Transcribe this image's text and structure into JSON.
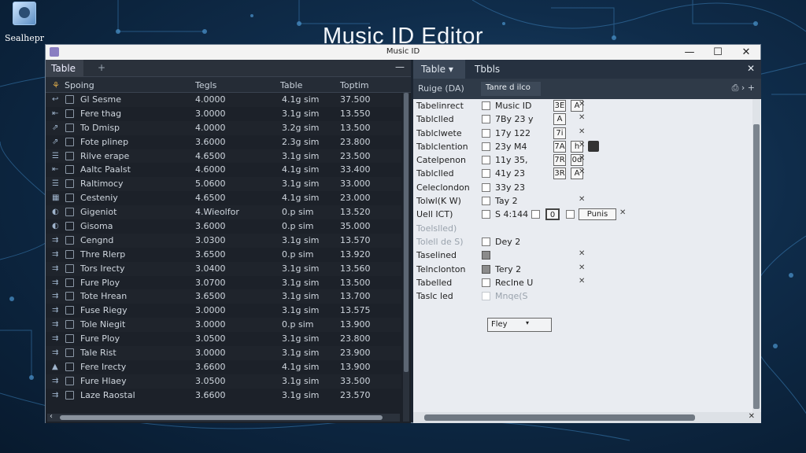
{
  "desktop": {
    "icon_label": "Sealhepr"
  },
  "heading": "Music ID Editor",
  "window": {
    "title": "Music ID",
    "controls": {
      "minimize": "—",
      "maximize": "☐",
      "close": "✕"
    }
  },
  "left_pane": {
    "tab": "Table",
    "add_tab": "+",
    "minimize": "—",
    "columns": [
      "Spoing",
      "Tegls",
      "Table",
      "Toptim"
    ],
    "rows": [
      {
        "icon": "↩",
        "name": "Gl Sesme",
        "c2": "4.0000",
        "c3": "4.1g sim",
        "c4": "37.500"
      },
      {
        "icon": "⇤",
        "name": "Fere thag",
        "c2": "3.0000",
        "c3": "3.1g sim",
        "c4": "13.550"
      },
      {
        "icon": "⇗",
        "name": "To Dmisp",
        "c2": "4.0000",
        "c3": "3.2g sim",
        "c4": "13.500"
      },
      {
        "icon": "⇗",
        "name": "Fote plinep",
        "c2": "3.6000",
        "c3": "2.3g sim",
        "c4": "23.800"
      },
      {
        "icon": "☰",
        "name": "Rilve erape",
        "c2": "4.6500",
        "c3": "3.1g sim",
        "c4": "23.500"
      },
      {
        "icon": "⇤",
        "name": "Aaltc Paalst",
        "c2": "4.6000",
        "c3": "4.1g sim",
        "c4": "33.400"
      },
      {
        "icon": "☰",
        "name": "Raltimocy",
        "c2": "5.0600",
        "c3": "3.1g sim",
        "c4": "33.000"
      },
      {
        "icon": "▦",
        "name": "Cesteniy",
        "c2": "4.6500",
        "c3": "4.1g sim",
        "c4": "23.000"
      },
      {
        "icon": "◐",
        "name": "Gigeniot",
        "c2": "4.Wieolfor",
        "c3": "0.p sim",
        "c4": "13.520"
      },
      {
        "icon": "◐",
        "name": "Gisoma",
        "c2": "3.6000",
        "c3": "0.p sim",
        "c4": "35.000"
      },
      {
        "icon": "⇉",
        "name": "Cengnd",
        "c2": "3.0300",
        "c3": "3.1g sim",
        "c4": "13.570"
      },
      {
        "icon": "⇉",
        "name": "Thre Rlerp",
        "c2": "3.6500",
        "c3": "0.p sim",
        "c4": "13.920"
      },
      {
        "icon": "⇉",
        "name": "Tors Irecty",
        "c2": "3.0400",
        "c3": "3.1g sim",
        "c4": "13.560"
      },
      {
        "icon": "⇉",
        "name": "Fure Ploy",
        "c2": "3.0700",
        "c3": "3.1g sim",
        "c4": "13.500"
      },
      {
        "icon": "⇉",
        "name": "Tote Hrean",
        "c2": "3.6500",
        "c3": "3.1g sim",
        "c4": "13.700"
      },
      {
        "icon": "⇉",
        "name": "Fuse Riegy",
        "c2": "3.0000",
        "c3": "3.1g sim",
        "c4": "13.575"
      },
      {
        "icon": "⇉",
        "name": "Tole Niegit",
        "c2": "3.0000",
        "c3": "0.p sim",
        "c4": "13.900"
      },
      {
        "icon": "⇉",
        "name": "Fure Ploy",
        "c2": "3.0500",
        "c3": "3.1g sim",
        "c4": "23.800"
      },
      {
        "icon": "⇉",
        "name": "Tale Rist",
        "c2": "3.0000",
        "c3": "3.1g sim",
        "c4": "23.900"
      },
      {
        "icon": "▲",
        "name": "Fere Irecty",
        "c2": "3.6600",
        "c3": "4.1g sim",
        "c4": "13.900"
      },
      {
        "icon": "⇉",
        "name": "Fure Hlaey",
        "c2": "3.0500",
        "c3": "3.1g sim",
        "c4": "33.500"
      },
      {
        "icon": "⇉",
        "name": "Laze Raostal",
        "c2": "3.6600",
        "c3": "3.1g sim",
        "c4": "23.570"
      }
    ],
    "left_arrow": "‹"
  },
  "right_pane": {
    "tabs": [
      "Table",
      "Tbbls"
    ],
    "close": "✕",
    "toolbar": {
      "range_label": "Ruige (DA)",
      "field": "Tanre d ilco",
      "tool_icons": "⎙ › +"
    },
    "properties": [
      {
        "label": "Tabelinrect",
        "checked": false,
        "value": "Music ID",
        "boxes": [
          "3E",
          "A"
        ],
        "x": "✕"
      },
      {
        "label": "Tablclled",
        "checked": false,
        "value": "7By 23 y",
        "boxes": [
          "A"
        ],
        "x": "✕"
      },
      {
        "label": "Tablclwete",
        "checked": false,
        "value": "17y 122",
        "boxes": [
          "7i"
        ],
        "x": "✕"
      },
      {
        "label": "Tablclention",
        "checked": false,
        "value": "23y M4",
        "boxes": [
          "7A",
          "h"
        ],
        "x": "✕",
        "ext": true
      },
      {
        "label": "Catelpenon",
        "checked": false,
        "value": "11y 35,",
        "boxes": [
          "7R",
          "0d"
        ],
        "x": "✕"
      },
      {
        "label": "Tablclled",
        "checked": false,
        "value": "41y 23",
        "boxes": [
          "3R",
          "A"
        ],
        "x": "✕"
      },
      {
        "label": "Celeclondon",
        "checked": false,
        "value": "33y 23",
        "boxes": [],
        "x": ""
      },
      {
        "label": "Tolwl(K W)",
        "checked": false,
        "value": "Tay 2",
        "boxes": [],
        "x": "✕"
      },
      {
        "label": "Uell ICT)",
        "checked": false,
        "value": "S 4:144",
        "boxes": [
          "0",
          "Punis"
        ],
        "x": "✕",
        "extra_cb": true
      },
      {
        "label": "Toelslled)",
        "checked": null,
        "value": "",
        "boxes": [],
        "x": "",
        "dim": true
      },
      {
        "label": "Tolell de S)",
        "checked": false,
        "value": "Dey 2",
        "boxes": [],
        "x": "",
        "dim": true
      },
      {
        "label": "Taselined",
        "checked": true,
        "value": "",
        "boxes": [],
        "x": "✕"
      },
      {
        "label": "Telnclonton",
        "checked": true,
        "value": "Tery 2",
        "boxes": [],
        "x": "✕"
      },
      {
        "label": "Tabelled",
        "checked": false,
        "value": "Reclne    U",
        "boxes": [],
        "x": "✕"
      },
      {
        "label": "Taslc led",
        "checked": false,
        "value": "Mnqe(S",
        "boxes": [],
        "x": "",
        "ghost": true
      }
    ],
    "combo_value": "Fley",
    "combo_arrow": "▾",
    "hscroll_arrow": "✕"
  }
}
